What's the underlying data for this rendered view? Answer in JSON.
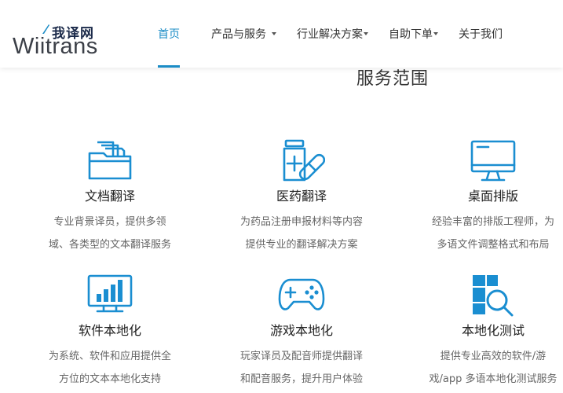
{
  "logo": {
    "cn": "我译网",
    "en": "Wiitrans"
  },
  "nav": [
    {
      "label": "首页",
      "active": true,
      "dropdown": false
    },
    {
      "label": "产品与服务",
      "active": false,
      "dropdown": true
    },
    {
      "label": "行业解决方案",
      "active": false,
      "dropdown": true
    },
    {
      "label": "自助下单",
      "active": false,
      "dropdown": true
    },
    {
      "label": "关于我们",
      "active": false,
      "dropdown": false
    }
  ],
  "section_title": "服务范围",
  "services": [
    {
      "title": "文档翻译",
      "desc": [
        "专业背景译员，提供多领",
        "域、各类型的文本翻译服务"
      ],
      "icon": "folder-documents-icon"
    },
    {
      "title": "医药翻译",
      "desc": [
        "为药品注册申报材料等内容",
        "提供专业的翻译解决方案"
      ],
      "icon": "medicine-bottle-pill-icon"
    },
    {
      "title": "桌面排版",
      "desc": [
        "经验丰富的排版工程师，为",
        "多语文件调整格式和布局"
      ],
      "icon": "desktop-monitor-icon"
    },
    {
      "title": "软件本地化",
      "desc": [
        "为系统、软件和应用提供全",
        "方位的文本本地化支持"
      ],
      "icon": "bar-chart-monitor-icon"
    },
    {
      "title": "游戏本地化",
      "desc": [
        "玩家译员及配音师提供翻译",
        "和配音服务，提升用户体验"
      ],
      "icon": "gamepad-icon"
    },
    {
      "title": "本地化测试",
      "desc": [
        "提供专业高效的软件/游",
        "戏/app 多语本地化测试服务"
      ],
      "icon": "magnifier-grid-icon"
    }
  ],
  "colors": {
    "accent": "#1b8cc6",
    "icon_blue": "#1a8ed1"
  }
}
